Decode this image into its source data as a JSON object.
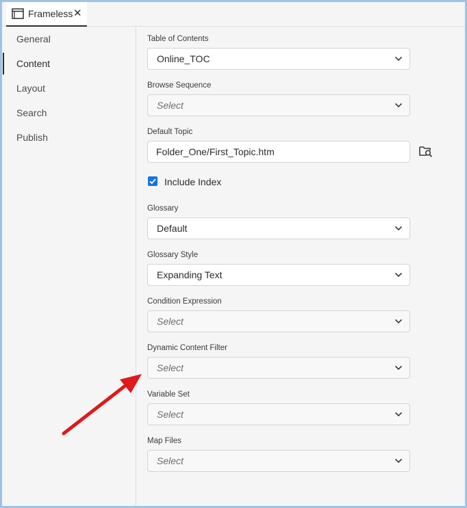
{
  "window": {
    "tab": {
      "label": "Frameless",
      "close_glyph": "✕",
      "icon": "window-icon"
    }
  },
  "sidebar": {
    "items": [
      {
        "label": "General",
        "active": false
      },
      {
        "label": "Content",
        "active": true
      },
      {
        "label": "Layout",
        "active": false
      },
      {
        "label": "Search",
        "active": false
      },
      {
        "label": "Publish",
        "active": false
      }
    ]
  },
  "content": {
    "toc": {
      "label": "Table of Contents",
      "value": "Online_TOC"
    },
    "browse_sequence": {
      "label": "Browse Sequence",
      "placeholder": "Select"
    },
    "default_topic": {
      "label": "Default Topic",
      "value": "Folder_One/First_Topic.htm",
      "browse_icon": "folder-search-icon"
    },
    "include_index": {
      "label": "Include Index",
      "checked": true
    },
    "glossary": {
      "label": "Glossary",
      "value": "Default"
    },
    "glossary_style": {
      "label": "Glossary Style",
      "value": "Expanding Text"
    },
    "condition_expression": {
      "label": "Condition Expression",
      "placeholder": "Select"
    },
    "dynamic_content_filter": {
      "label": "Dynamic Content Filter",
      "placeholder": "Select"
    },
    "variable_set": {
      "label": "Variable Set",
      "placeholder": "Select"
    },
    "map_files": {
      "label": "Map Files",
      "placeholder": "Select"
    }
  },
  "colors": {
    "frame_border": "#9fc3e6",
    "checkbox": "#1473e6",
    "annotation_arrow": "#e0191c"
  }
}
